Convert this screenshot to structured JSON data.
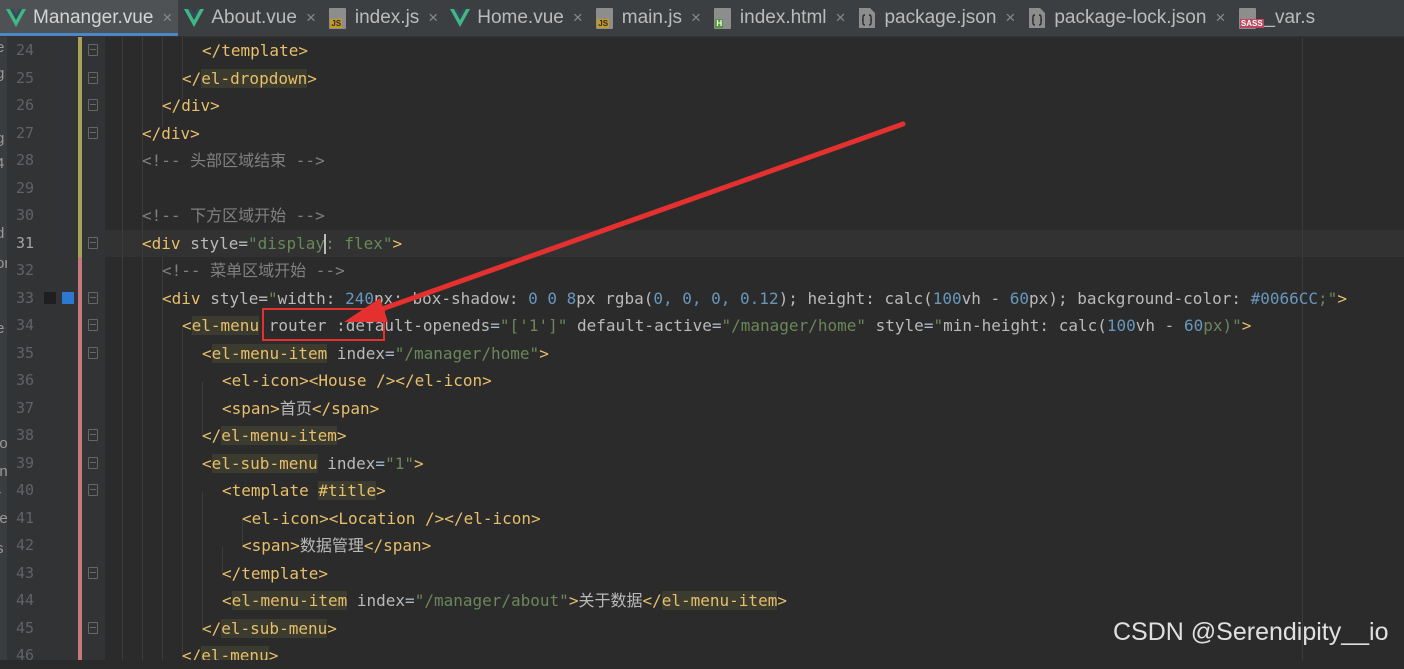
{
  "tabs": [
    {
      "label": "Mananger.vue",
      "icon": "vue-icon",
      "active": true
    },
    {
      "label": "About.vue",
      "icon": "vue-icon"
    },
    {
      "label": "index.js",
      "icon": "js-file-icon",
      "badge": "JS"
    },
    {
      "label": "Home.vue",
      "icon": "vue-icon"
    },
    {
      "label": "main.js",
      "icon": "js-file-icon",
      "badge": "JS"
    },
    {
      "label": "index.html",
      "icon": "html-file-icon",
      "badge": "H"
    },
    {
      "label": "package.json",
      "icon": "json-file-icon"
    },
    {
      "label": "package-lock.json",
      "icon": "json-file-icon"
    },
    {
      "label": "_var.s",
      "icon": "sass-file-icon",
      "badge": "SASS"
    }
  ],
  "close_glyph": "×",
  "line_numbers": [
    "24",
    "25",
    "26",
    "27",
    "28",
    "29",
    "30",
    "31",
    "32",
    "33",
    "34",
    "35",
    "36",
    "37",
    "38",
    "39",
    "40",
    "41",
    "42",
    "43",
    "44",
    "45",
    "46"
  ],
  "current_line": "31",
  "left_strip_chars": [
    "e",
    "g",
    "i",
    "g",
    "4",
    "l",
    "d",
    "or",
    "e",
    "l",
    "I",
    "lo",
    "in",
    "r",
    "le",
    "s"
  ],
  "code": {
    "l24": {
      "open": "</",
      "tag": "template",
      "close": ">"
    },
    "l25": {
      "open": "</",
      "tag": "el-dropdown",
      "close": ">"
    },
    "l26": {
      "open": "</",
      "tag": "div",
      "close": ">"
    },
    "l27": {
      "open": "</",
      "tag": "div",
      "close": ">"
    },
    "l28": {
      "comment": "<!-- 头部区域结束 -->"
    },
    "l30": {
      "comment": "<!-- 下方区域开始 -->"
    },
    "l31": {
      "open": "<",
      "tag": "div",
      "attr": "style",
      "eq": "=",
      "str_a": "\"display",
      "str_b": ": flex\"",
      "close": ">"
    },
    "l32": {
      "comment": "<!-- 菜单区域开始 -->"
    },
    "l33": {
      "open": "<",
      "tag": "div",
      "attr": "style",
      "eq": "=",
      "q": "\"",
      "p1": "width: ",
      "n1": "240",
      "p2": "px; box-shadow: ",
      "n2": "0 0 8",
      "p3": "px rgba(",
      "n3": "0, 0, 0, 0.12",
      "p4": "); height: calc(",
      "n4": "100",
      "p5": "vh - ",
      "n5": "60",
      "p6": "px); background-color: ",
      "n6": "#0066CC",
      "p7": ";\"",
      "close": ">"
    },
    "l34": {
      "open": "<",
      "tag": "el-menu",
      "a1": "router",
      "a2": ":default-openeds",
      "s2": "\"['1']\"",
      "a3": "default-active",
      "s3": "\"/manager/home\"",
      "a4": "style",
      "q": "\"",
      "p1": "min-height: calc(",
      "n1": "100",
      "p2": "vh - ",
      "n2": "60",
      "p3": "px)\"",
      "close": ">"
    },
    "l35": {
      "open": "<",
      "tag": "el-menu-item",
      "a1": "index",
      "s1": "\"/manager/home\"",
      "close": ">"
    },
    "l36": {
      "open": "<",
      "tag": "el-icon",
      "mid": "><House /></",
      "tag2": "el-icon",
      "close": ">"
    },
    "l37": {
      "open": "<",
      "tag": "span",
      "text": "首页",
      "open2": "</",
      "tag2": "span",
      "close": ">"
    },
    "l38": {
      "open": "</",
      "tag": "el-menu-item",
      "close": ">"
    },
    "l39": {
      "open": "<",
      "tag": "el-sub-menu",
      "a1": "index",
      "s1": "\"1\"",
      "close": ">"
    },
    "l40": {
      "open": "<",
      "tag": "template",
      "a1": "#title",
      "close": ">"
    },
    "l41": {
      "open": "<",
      "tag": "el-icon",
      "mid": "><Location /></",
      "tag2": "el-icon",
      "close": ">"
    },
    "l42": {
      "open": "<",
      "tag": "span",
      "text": "数据管理",
      "open2": "</",
      "tag2": "span",
      "close": ">"
    },
    "l43": {
      "open": "</",
      "tag": "template",
      "close": ">"
    },
    "l44": {
      "open": "<",
      "tag": "el-menu-item",
      "a1": "index",
      "s1": "\"/manager/about\"",
      "text": "关于数据",
      "open2": "</",
      "tag2": "el-menu-item",
      "close": ">"
    },
    "l45": {
      "open": "</",
      "tag": "el-sub-menu",
      "close": ">"
    },
    "l46": {
      "open": "</",
      "tag": "el-menu",
      "close": ">"
    }
  },
  "colors": {
    "background": "#2b2b2b",
    "tag": "#e8bf6a",
    "string": "#6a8759",
    "number": "#6897bb",
    "comment": "#808080",
    "annotation": "#e53030"
  },
  "watermark": "CSDN @Serendipity__io"
}
